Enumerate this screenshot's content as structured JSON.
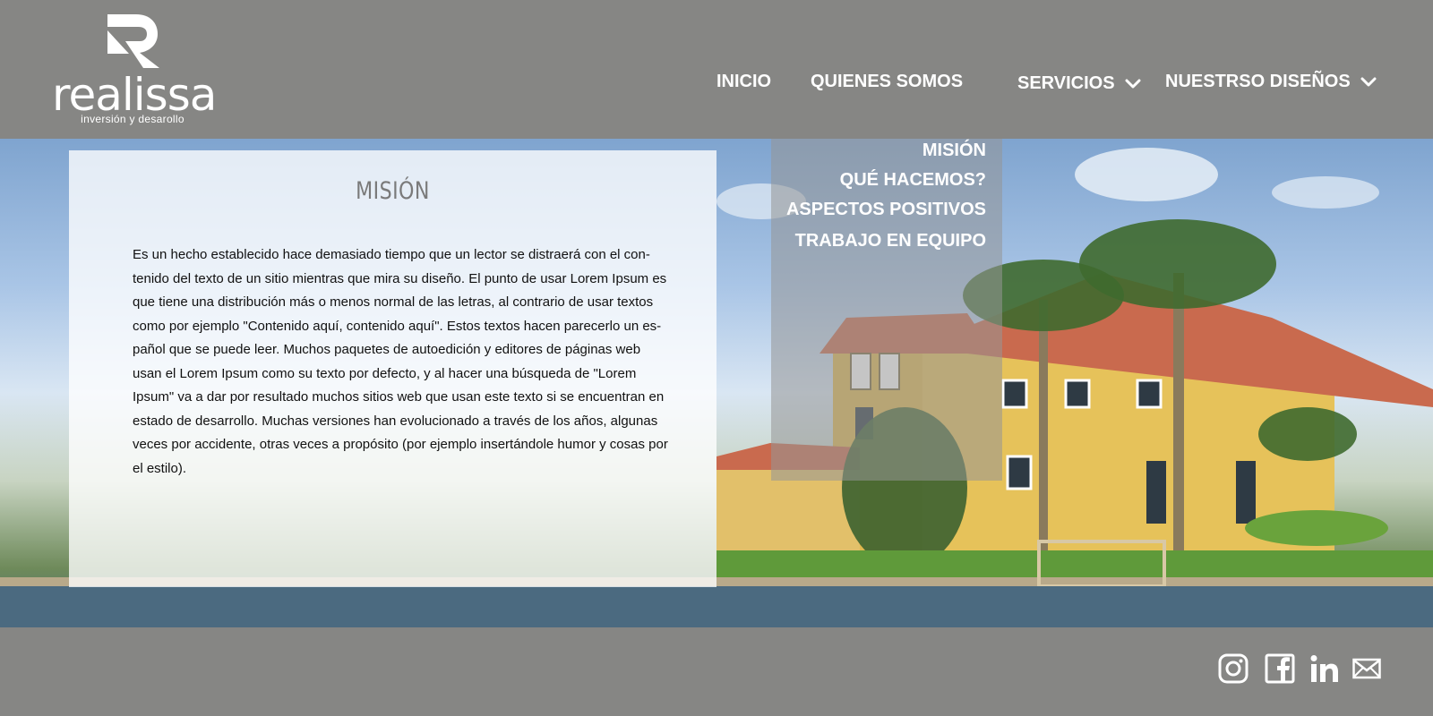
{
  "brand": {
    "name": "realissa",
    "tagline": "inversión y desarollo"
  },
  "nav": {
    "items": [
      {
        "label": "INICIO"
      },
      {
        "label": "QUIENES SOMOS"
      },
      {
        "label": "SERVICIOS"
      },
      {
        "label": "NUESTRSO DISEÑOS"
      }
    ]
  },
  "submenu": {
    "items": [
      {
        "label": "MISIÓN"
      },
      {
        "label": "QUÉ HACEMOS?"
      },
      {
        "label": "ASPECTOS POSITIVOS"
      },
      {
        "label": "TRABAJO EN EQUIPO"
      }
    ]
  },
  "panel": {
    "title": "MISIÓN",
    "lines": [
      "Es un hecho establecido hace demasiado tiempo que un lector se distraerá con el con-",
      "tenido del texto de un sitio mientras que mira su diseño. El punto de usar Lorem Ipsum es",
      "que tiene una distribución más o menos normal de las letras, al contrario de usar textos",
      "como por ejemplo \"Contenido aquí, contenido aquí\". Estos textos hacen parecerlo un es-",
      "pañol que se puede leer. Muchos paquetes de autoedición y editores de páginas web",
      "usan el Lorem Ipsum como su texto por defecto, y al hacer una búsqueda de \"Lorem",
      "Ipsum\" va a dar por resultado muchos sitios web que usan este texto si se encuentran en",
      "estado de desarrollo. Muchas versiones han evolucionado a través de los años, algunas",
      "veces por accidente, otras veces a propósito (por ejemplo insertándole humor y cosas por",
      "el estilo)."
    ]
  },
  "footer": {
    "social_icons": [
      "instagram-icon",
      "facebook-icon",
      "linkedin-icon",
      "mail-icon"
    ]
  },
  "colors": {
    "header_bg": "#868684",
    "text_light": "#ffffff",
    "panel_title": "#7a7a7a"
  }
}
